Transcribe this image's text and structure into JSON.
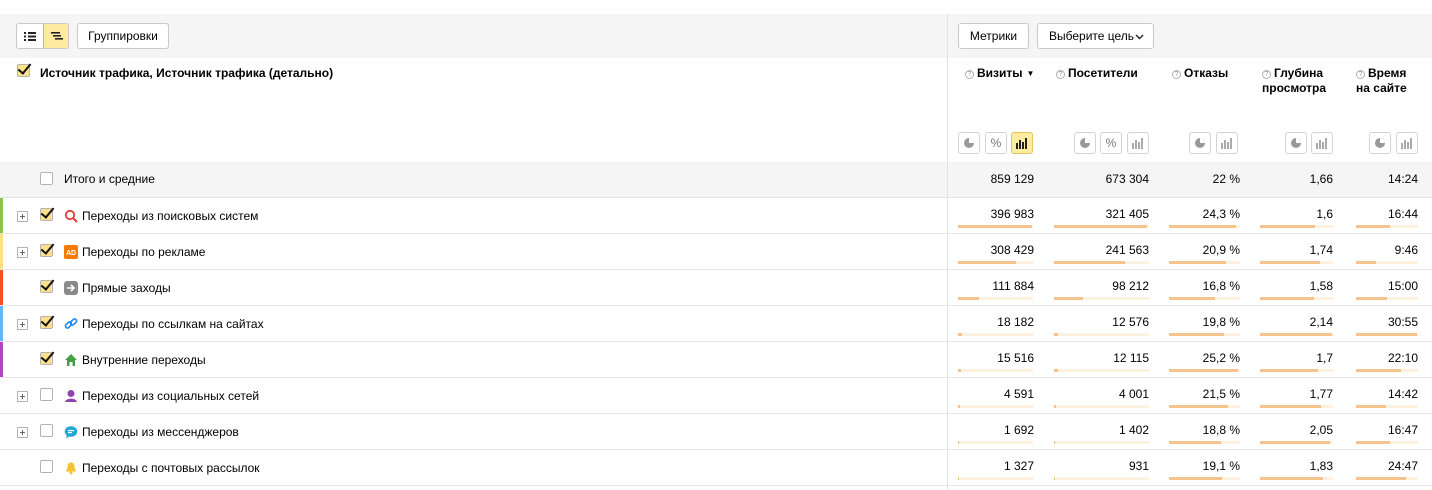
{
  "toolbar": {
    "groupings_label": "Группировки",
    "metrics_label": "Метрики",
    "goal_label": "Выберите цель"
  },
  "dimension_title": "Источник трафика, Источник трафика (детально)",
  "columns": [
    {
      "label": "Визиты",
      "sort": "▼"
    },
    {
      "label": "Посетители"
    },
    {
      "label": "Отказы"
    },
    {
      "label": "Глубина просмотра"
    },
    {
      "label": "Время на сайте"
    }
  ],
  "total": {
    "label": "Итого и средние",
    "values": [
      "859 129",
      "673 304",
      "22 %",
      "1,66",
      "14:24"
    ]
  },
  "rows": [
    {
      "label": "Переходы из поисковых систем",
      "icon": "search-icon",
      "color": "#8bc34a",
      "checked": true,
      "expandable": true,
      "values": [
        "396 983",
        "321 405",
        "24,3 %",
        "1,6",
        "16:44"
      ],
      "fills": [
        0.98,
        0.98,
        0.94,
        0.75,
        0.55
      ]
    },
    {
      "label": "Переходы по рекламе",
      "icon": "ad-icon",
      "color": "#ffe082",
      "checked": true,
      "expandable": true,
      "values": [
        "308 429",
        "241 563",
        "20,9 %",
        "1,74",
        "9:46"
      ],
      "fills": [
        0.77,
        0.75,
        0.8,
        0.82,
        0.32
      ]
    },
    {
      "label": "Прямые заходы",
      "icon": "direct-arrow-icon",
      "color": "#f4511e",
      "checked": true,
      "expandable": false,
      "values": [
        "111 884",
        "98 212",
        "16,8 %",
        "1,58",
        "15:00"
      ],
      "fills": [
        0.28,
        0.3,
        0.65,
        0.74,
        0.5
      ]
    },
    {
      "label": "Переходы по ссылкам на сайтах",
      "icon": "link-icon",
      "color": "#64b5f6",
      "checked": true,
      "expandable": true,
      "values": [
        "18 182",
        "12 576",
        "19,8 %",
        "2,14",
        "30:55"
      ],
      "fills": [
        0.05,
        0.04,
        0.77,
        0.98,
        0.98
      ]
    },
    {
      "label": "Внутренние переходы",
      "icon": "home-icon",
      "color": "#ab47bc",
      "checked": true,
      "expandable": false,
      "values": [
        "15 516",
        "12 115",
        "25,2 %",
        "1,7",
        "22:10"
      ],
      "fills": [
        0.04,
        0.04,
        0.97,
        0.8,
        0.73
      ]
    },
    {
      "label": "Переходы из социальных сетей",
      "icon": "social-person-icon",
      "color": "",
      "checked": false,
      "expandable": true,
      "values": [
        "4 591",
        "4 001",
        "21,5 %",
        "1,77",
        "14:42"
      ],
      "fills": [
        0.02,
        0.02,
        0.83,
        0.83,
        0.48
      ]
    },
    {
      "label": "Переходы из мессенджеров",
      "icon": "messenger-icon",
      "color": "",
      "checked": false,
      "expandable": true,
      "values": [
        "1 692",
        "1 402",
        "18,8 %",
        "2,05",
        "16:47"
      ],
      "fills": [
        0.01,
        0.01,
        0.73,
        0.96,
        0.55
      ]
    },
    {
      "label": "Переходы с почтовых рассылок",
      "icon": "bell-icon",
      "color": "",
      "checked": false,
      "expandable": false,
      "values": [
        "1 327",
        "931",
        "19,1 %",
        "1,83",
        "24:47"
      ],
      "fills": [
        0.01,
        0.01,
        0.74,
        0.86,
        0.81
      ]
    }
  ]
}
